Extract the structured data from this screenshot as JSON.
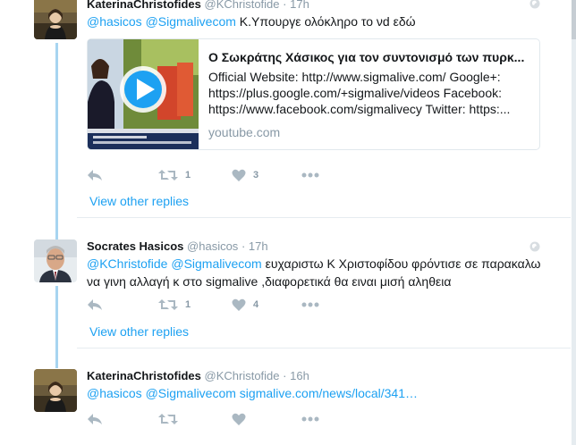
{
  "tweets": [
    {
      "name": "KaterinaChristofides",
      "handle": "@KChristofide",
      "sep": "·",
      "time": "17h",
      "text_mentions": "@hasicos @Sigmalivecom",
      "text_body": " Κ.Υπουργε ολόκληρο το νd εδώ",
      "card": {
        "title": "Ο Σωκράτης Χάσικος για τον συντονισμό των πυρκ...",
        "description": "Official Website: http://www.sigmalive.com/ Google+: https://plus.google.com/+sigmalive/videos Facebook: https://www.facebook.com/sigmalivecy Twitter: https:...",
        "domain": "youtube.com"
      },
      "retweets": "1",
      "likes": "3",
      "view_other_replies": "View other replies"
    },
    {
      "name": "Socrates Hasicos",
      "handle": "@hasicos",
      "sep": "·",
      "time": "17h",
      "text_mentions": "@KChristofide @Sigmalivecom",
      "text_body": " ευχαριστω Κ Χριστοφίδου φρόντισε σε παρακαλω να γινη αλλαγή κ στο sigmalive ,διαφορετικά θα ειναι μισή αληθεια",
      "retweets": "1",
      "likes": "4",
      "view_other_replies": "View other replies"
    },
    {
      "name": "KaterinaChristofides",
      "handle": "@KChristofide",
      "sep": "·",
      "time": "16h",
      "text_mentions": "@hasicos @Sigmalivecom",
      "text_link": " sigmalive.com/news/local/341…"
    }
  ],
  "colors": {
    "link": "#1da1f2",
    "muted": "#8899a6",
    "thread": "#a7d4f0"
  },
  "icons": [
    "reply-icon",
    "retweet-icon",
    "heart-icon",
    "more-icon",
    "globe-icon",
    "play-icon"
  ]
}
